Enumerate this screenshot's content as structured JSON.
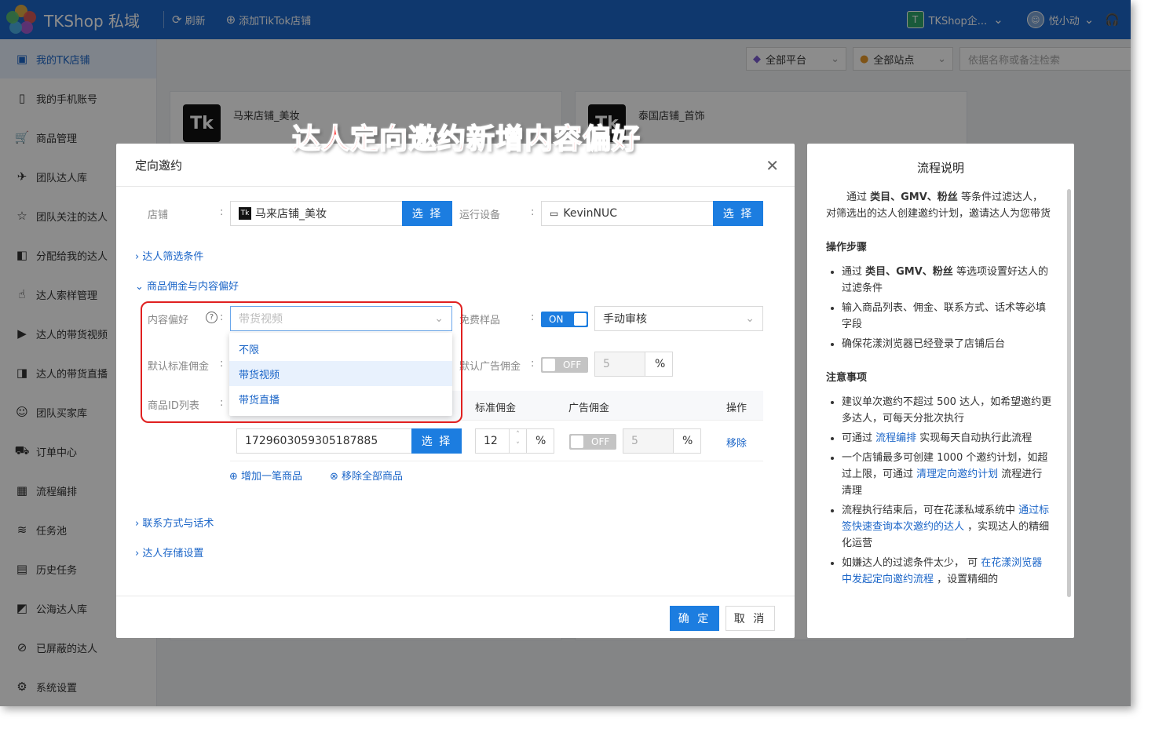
{
  "app": {
    "title": "TKShop 私域",
    "refresh": "刷新",
    "add_shop": "添加TikTok店铺",
    "team": "TKShop企...",
    "user": "悦小动",
    "team_initial": "T"
  },
  "sidebar": {
    "items": [
      {
        "label": "我的TK店铺",
        "icon": "store-icon"
      },
      {
        "label": "我的手机账号",
        "icon": "phone-icon"
      },
      {
        "label": "商品管理",
        "icon": "cart-icon"
      },
      {
        "label": "团队达人库",
        "icon": "users-icon"
      },
      {
        "label": "团队关注的达人",
        "icon": "star-icon"
      },
      {
        "label": "分配给我的达人",
        "icon": "assign-icon"
      },
      {
        "label": "达人索样管理",
        "icon": "hand-icon"
      },
      {
        "label": "达人的带货视频",
        "icon": "video-icon"
      },
      {
        "label": "达人的带货直播",
        "icon": "live-icon"
      },
      {
        "label": "团队买家库",
        "icon": "buyer-icon"
      },
      {
        "label": "订单中心",
        "icon": "truck-icon"
      },
      {
        "label": "流程编排",
        "icon": "calendar-icon"
      },
      {
        "label": "任务池",
        "icon": "layers-icon"
      },
      {
        "label": "历史任务",
        "icon": "clipboard-icon"
      },
      {
        "label": "公海达人库",
        "icon": "image-icon"
      },
      {
        "label": "已屏蔽的达人",
        "icon": "block-icon"
      },
      {
        "label": "系统设置",
        "icon": "gear-icon"
      }
    ]
  },
  "filters": {
    "platform": "全部平台",
    "site": "全部站点",
    "search_placeholder": "依据名称或备注检索"
  },
  "cards": [
    {
      "name": "马来店铺_美妆"
    },
    {
      "name": "泰国店铺_首饰"
    }
  ],
  "annotation": "达人定向邀约新增内容偏好",
  "dialog": {
    "title": "定向邀约",
    "shop_label": "店铺",
    "shop_value": "马来店铺_美妆",
    "select_btn": "选 择",
    "device_label": "运行设备",
    "device_value": "KevinNUC",
    "section_filter": "达人筛选条件",
    "section_commission": "商品佣金与内容偏好",
    "content_pref_label": "内容偏好",
    "content_pref_placeholder": "带货视频",
    "pref_options": [
      "不限",
      "带货视频",
      "带货直播"
    ],
    "free_sample_label": "免费样品",
    "free_sample_toggle": "ON",
    "review_value": "手动审核",
    "std_commission_label": "默认标准佣金",
    "ad_commission_label": "默认广告佣金",
    "ad_toggle": "OFF",
    "ad_value": "5",
    "percent": "%",
    "product_list_label": "商品ID列表",
    "th_std": "标准佣金",
    "th_ad": "广告佣金",
    "th_op": "操作",
    "product_id": "1729603059305187885",
    "std_value": "12",
    "row_ad_toggle": "OFF",
    "row_ad_value": "5",
    "remove": "移除",
    "add_product": "增加一笔商品",
    "remove_all": "移除全部商品",
    "section_contact": "联系方式与话术",
    "section_storage": "达人存储设置",
    "ok": "确 定",
    "cancel": "取 消"
  },
  "help": {
    "title": "流程说明",
    "intro_pre": "通过 ",
    "intro_bold": "类目、GMV、粉丝",
    "intro_post": " 等条件过滤达人，对筛选出的达人创建邀约计划，邀请达人为您带货",
    "steps_title": "操作步骤",
    "step1_pre": "通过 ",
    "step1_bold": "类目、GMV、粉丝",
    "step1_post": " 等选项设置好达人的过滤条件",
    "step2": "输入商品列表、佣金、联系方式、话术等必填字段",
    "step3": "确保花漾浏览器已经登录了店铺后台",
    "notes_title": "注意事项",
    "note1": "建议单次邀约不超过 500 达人，如希望邀约更多达人，可每天分批次执行",
    "note2_pre": "可通过 ",
    "note2_link": "流程编排",
    "note2_post": " 实现每天自动执行此流程",
    "note3_pre": "一个店铺最多可创建 1000 个邀约计划，如超过上限，可通过 ",
    "note3_link": "清理定向邀约计划",
    "note3_post": " 流程进行清理",
    "note4_pre": "流程执行结束后，可在花漾私域系统中 ",
    "note4_link": "通过标签快速查询本次邀约的达人",
    "note4_post": " ，实现达人的精细化运营",
    "note5_pre": "如嫌达人的过滤条件太少， 可 ",
    "note5_link": "在花漾浏览器中发起定向邀约流程",
    "note5_post": " ，设置精细的"
  },
  "colors": {
    "primary": "#1c66c8",
    "button": "#1c7de0",
    "annotation": "#ff4a4a",
    "highlight_box": "#e02020"
  }
}
